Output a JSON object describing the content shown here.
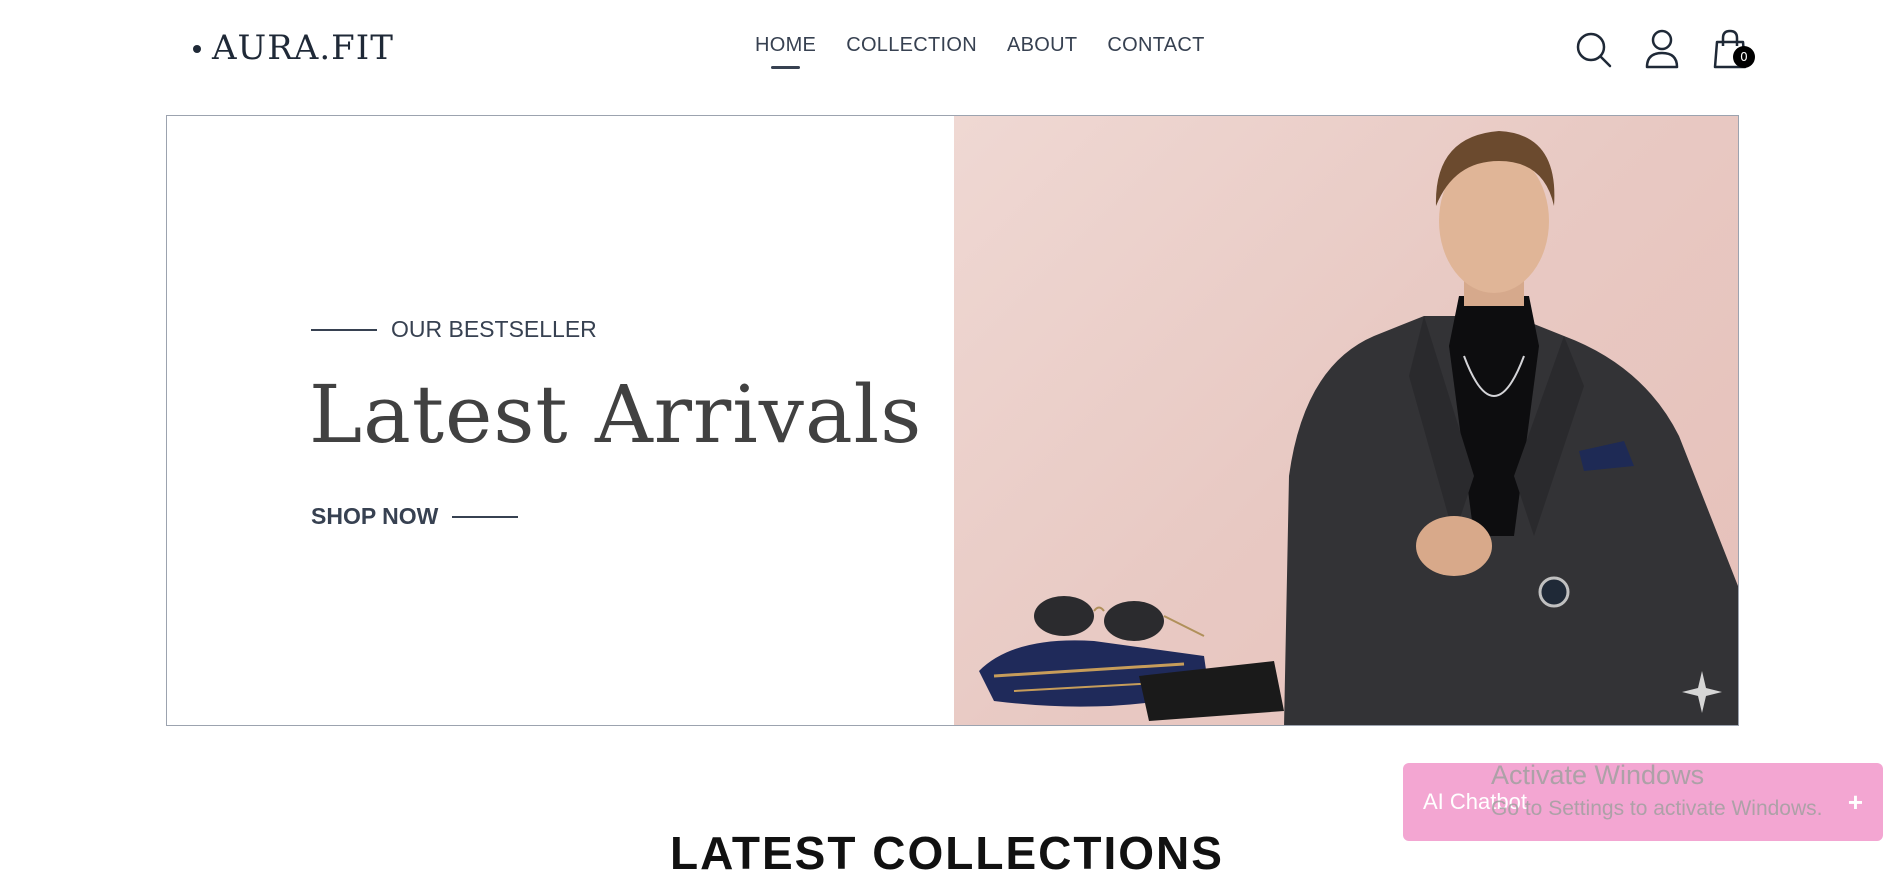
{
  "brand": {
    "name": "AURA.FIT"
  },
  "nav": {
    "items": [
      {
        "label": "HOME",
        "active": true
      },
      {
        "label": "COLLECTION",
        "active": false
      },
      {
        "label": "ABOUT",
        "active": false
      },
      {
        "label": "CONTACT",
        "active": false
      }
    ]
  },
  "header_icons": {
    "search": "search-icon",
    "profile": "profile-icon",
    "cart": "cart-icon",
    "cart_count": "0"
  },
  "hero": {
    "eyebrow": "OUR BESTSELLER",
    "title": "Latest Arrivals",
    "cta": "SHOP NOW",
    "image": "model-in-suit-photo"
  },
  "section": {
    "heading": "LATEST COLLECTIONS"
  },
  "chatbot": {
    "label": "AI Chatbot",
    "plus": "+"
  },
  "watermark": {
    "title": "Activate Windows",
    "subtitle": "Go to Settings to activate Windows."
  },
  "colors": {
    "hero_bg": "#e8c9c3",
    "chatbot_bg": "#f3a6d2",
    "text": "#374151"
  }
}
